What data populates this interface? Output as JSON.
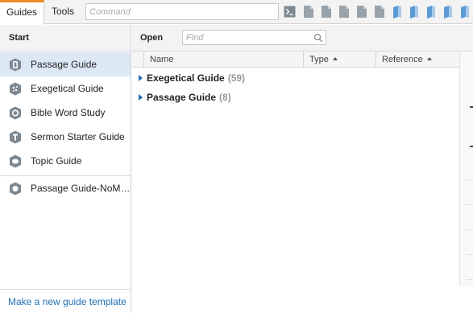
{
  "tabs": [
    {
      "label": "Guides",
      "active": true
    },
    {
      "label": "Tools",
      "active": false
    }
  ],
  "command": {
    "placeholder": "Command"
  },
  "toolbar_icons": [
    "terminal-icon",
    "document-icon",
    "document-icon",
    "document-icon",
    "document-icon",
    "document-icon",
    "book-icon",
    "book-icon",
    "book-icon",
    "book-icon",
    "book-icon"
  ],
  "left_panel": {
    "title": "Start",
    "guides": [
      {
        "label": "Passage Guide",
        "icon": "passage-guide-icon",
        "selected": true
      },
      {
        "label": "Exegetical Guide",
        "icon": "exegetical-guide-icon",
        "selected": false
      },
      {
        "label": "Bible Word Study",
        "icon": "word-study-icon",
        "selected": false
      },
      {
        "label": "Sermon Starter Guide",
        "icon": "sermon-starter-icon",
        "selected": false
      },
      {
        "label": "Topic Guide",
        "icon": "topic-guide-icon",
        "selected": false
      }
    ],
    "custom_guides": [
      {
        "label": "Passage Guide-NoM…",
        "icon": "custom-guide-icon"
      }
    ],
    "footer_link": "Make a new guide template"
  },
  "right_panel": {
    "title": "Open",
    "find_placeholder": "Find",
    "columns": [
      "Name",
      "Type",
      "Reference"
    ],
    "rows": [
      {
        "label": "Exegetical Guide",
        "count": "(59)"
      },
      {
        "label": "Passage Guide",
        "count": "(8)"
      }
    ]
  },
  "colors": {
    "accent": "#f08a24",
    "link": "#1f6fb5",
    "selection": "#dde8f5",
    "icon_gray": "#8a939c",
    "icon_blue": "#5b9bd5"
  }
}
